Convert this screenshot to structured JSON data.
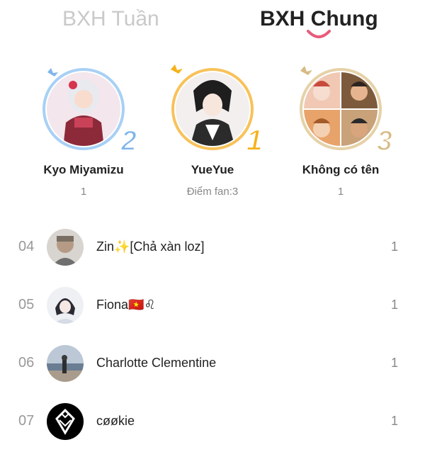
{
  "tabs": {
    "weekly": "BXH Tuần",
    "general": "BXH Chung",
    "active": "general"
  },
  "colors": {
    "accent": "#e85b7a",
    "gold": "#f6b21b",
    "silver": "#7fb6ea",
    "bronze": "#d8bb84"
  },
  "podium": [
    {
      "rank": "2",
      "name": "Kyo Miyamizu",
      "score": "1",
      "frame": "silver"
    },
    {
      "rank": "1",
      "name": "YueYue",
      "score": "Điểm fan:3",
      "frame": "gold"
    },
    {
      "rank": "3",
      "name": "Không có tên",
      "score": "1",
      "frame": "bronze"
    }
  ],
  "list": [
    {
      "rank": "04",
      "name": "Zin✨[Chả xàn loz]",
      "score": "1",
      "avatar": "photo-avatar"
    },
    {
      "rank": "05",
      "name": "Fiona🇻🇳♌",
      "score": "1",
      "avatar": "anime-avatar"
    },
    {
      "rank": "06",
      "name": "Charlotte Clementine",
      "score": "1",
      "avatar": "beach-avatar"
    },
    {
      "rank": "07",
      "name": "cøøkie",
      "score": "1",
      "avatar": "logo-avatar"
    }
  ]
}
